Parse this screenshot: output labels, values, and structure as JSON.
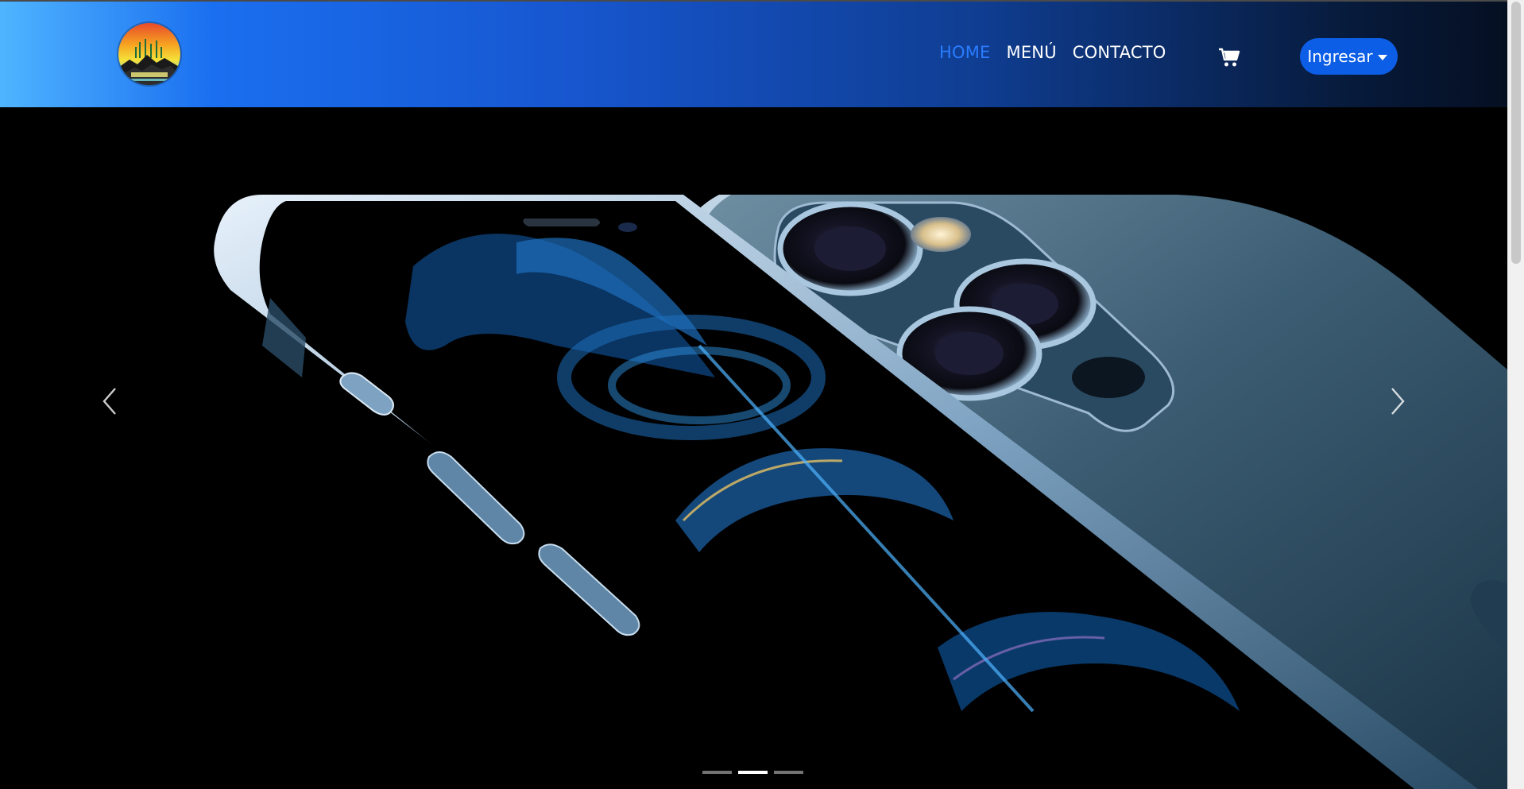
{
  "navbar": {
    "logo_icon": "mountain-sunset-logo",
    "links": [
      {
        "label": "HOME",
        "active": true
      },
      {
        "label": "MENÚ",
        "active": false
      },
      {
        "label": "CONTACTO",
        "active": false
      }
    ],
    "cart_icon": "shopping-cart-icon",
    "login_label": "Ingresar",
    "colors": {
      "gradient_start": "#4fb5ff",
      "gradient_mid": "#1756cf",
      "gradient_end": "#050f22",
      "active_link": "#2a7cff",
      "button": "#0d5ee6"
    }
  },
  "carousel": {
    "slide_image": "iphone-12-pro-pacific-blue",
    "prev_icon": "chevron-left-icon",
    "next_icon": "chevron-right-icon",
    "active_index": 1,
    "indicator_count": 3
  }
}
